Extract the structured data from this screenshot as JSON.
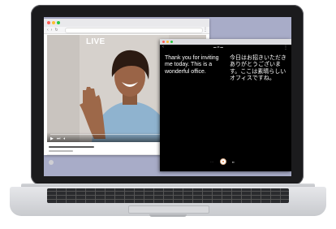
{
  "video": {
    "badge": "LIVE",
    "progress": 0.0
  },
  "translation": {
    "source_text": "Thank you for inviting me today. This is a wonderful office.",
    "target_text": "今日はお招きいただきありがとうございます。ここは素晴らしいオフィスですね。"
  },
  "icons": {
    "back": "chevron-left-icon",
    "menu": "menu-icon",
    "mic": "microphone-icon",
    "play": "play-icon",
    "volume": "volume-icon"
  },
  "colors": {
    "desktop": "#a8acc8",
    "translation_bg": "#000000",
    "traffic_red": "#ff5f57",
    "traffic_yellow": "#febc2e",
    "traffic_green": "#28c840",
    "mic_accent": "#e07b39"
  }
}
